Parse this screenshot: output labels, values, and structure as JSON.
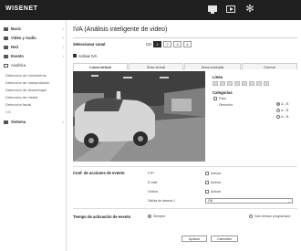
{
  "app": {
    "logo_text": "WISENET"
  },
  "topbar": {
    "icons": [
      "monitor-icon",
      "playback-icon",
      "gear-icon"
    ]
  },
  "sidebar": {
    "items": [
      {
        "label": "Basic",
        "icon": "camera-icon"
      },
      {
        "label": "Video y Audio",
        "icon": "video-icon"
      },
      {
        "label": "Red",
        "icon": "network-icon"
      },
      {
        "label": "Evento",
        "icon": "event-icon"
      },
      {
        "label": "Analítica",
        "icon": "analytics-icon"
      }
    ],
    "sub_items": [
      "Detección de movimiento",
      "Detección de manipulación",
      "Detección de desenfoque",
      "Detección de niebla",
      "Detección facial",
      "IVA"
    ],
    "system": {
      "label": "Sistema",
      "icon": "system-icon"
    }
  },
  "page": {
    "title": "IVA (Análisis inteligente de video)"
  },
  "channel": {
    "label": "Seleccionar canal",
    "prefix": "CH",
    "options": [
      "1",
      "2",
      "3",
      "4"
    ],
    "selected": "1"
  },
  "enable_iva": {
    "label": "Activar IVA",
    "checked": true
  },
  "tabs": [
    "Línea virtual",
    "Área virtual",
    "Área excluida",
    "Común"
  ],
  "active_tab": "Línea virtual",
  "line_panel": {
    "title": "Línea",
    "numbers": [
      "1",
      "2",
      "3",
      "4",
      "5",
      "6",
      "7",
      "8"
    ],
    "categories_label": "Categorías",
    "pass_label": "Paso",
    "direction_label": "Dirección",
    "direction_options": [
      "A→B",
      "A←B",
      "A↔B"
    ]
  },
  "actions": {
    "title": "Conf. de acciones de evento",
    "rows": [
      {
        "label": "FTP",
        "check_label": "Activar"
      },
      {
        "label": "E-mail",
        "check_label": "Activar"
      },
      {
        "label": "Grabar",
        "check_label": "Activar"
      }
    ],
    "alarm_label": "Salida de alarma 1",
    "alarm_value": "Off"
  },
  "activation": {
    "title": "Tiempo de activación de evento",
    "always_label": "Siempre",
    "scheduled_label": "Sólo tiempo programado"
  },
  "buttons": {
    "apply": "Aplicar",
    "cancel": "Cancelar"
  }
}
